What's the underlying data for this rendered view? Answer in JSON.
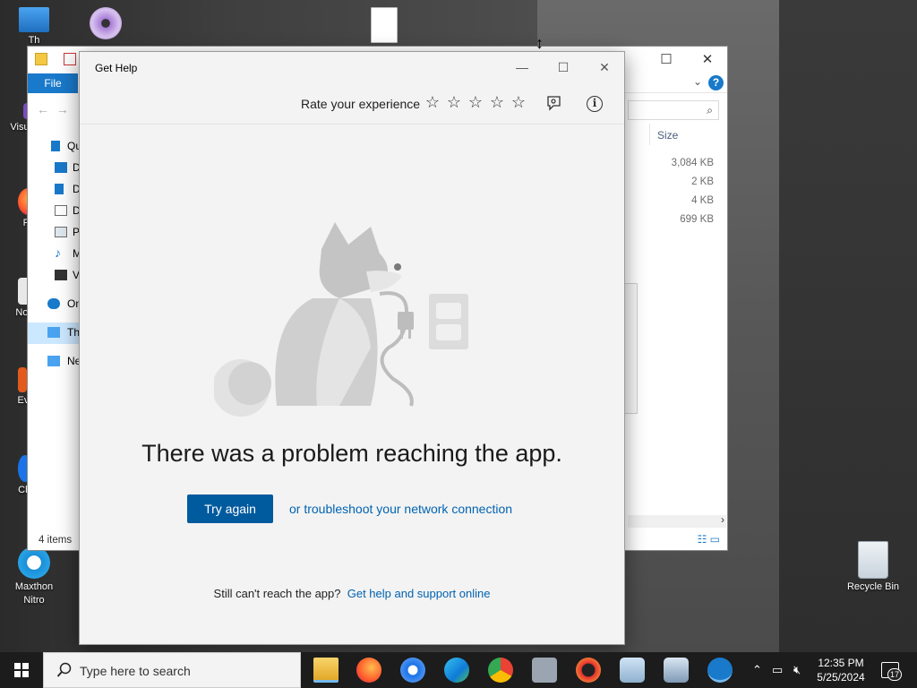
{
  "desktop": {
    "icons": [
      {
        "label": "Th",
        "name": "this-pc-icon"
      },
      {
        "label": "Visu",
        "name": "visual-studio-icon"
      },
      {
        "label": "F",
        "name": "firefox-desktop-icon"
      },
      {
        "label": "Note",
        "name": "notepad-icon"
      },
      {
        "label": "Eve",
        "name": "everything-icon"
      },
      {
        "label": "Chr",
        "name": "chrome-desktop-icon"
      },
      {
        "label": "Maxthon Nitro",
        "name": "maxthon-nitro-icon"
      },
      {
        "label": "Recycle Bin",
        "name": "recycle-bin-icon"
      }
    ]
  },
  "explorer": {
    "file_tab": "File",
    "help_label": "?",
    "sidebar": [
      {
        "label": "Qu",
        "color": "#1979ca"
      },
      {
        "label": "D",
        "color": "#1979ca"
      },
      {
        "label": "D",
        "color": "#1979ca"
      },
      {
        "label": "D",
        "color": "#6d6d6d"
      },
      {
        "label": "P",
        "color": "#6d6d6d"
      },
      {
        "label": "M",
        "color": "#1979ca"
      },
      {
        "label": "V",
        "color": "#333333"
      },
      {
        "label": "On",
        "color": "#1979ca"
      },
      {
        "label": "Th",
        "color": "#1979ca"
      },
      {
        "label": "Ne",
        "color": "#1979ca"
      }
    ],
    "size_header": "Size",
    "sizes": [
      "3,084 KB",
      "2 KB",
      "4 KB",
      "699 KB"
    ],
    "status": "4 items"
  },
  "get_help": {
    "title": "Get Help",
    "rate_label": "Rate your experience",
    "stars": [
      "☆",
      "☆",
      "☆",
      "☆",
      "☆"
    ],
    "error_heading": "There was a problem reaching the app.",
    "try_again": "Try again",
    "troubleshoot_link": "or troubleshoot your network connection",
    "still_text": "Still can't reach the app?",
    "support_link": "Get help and support online",
    "accent": "#005a9e"
  },
  "taskbar": {
    "search_placeholder": "Type here to search",
    "time": "12:35 PM",
    "date": "5/25/2024",
    "notification_count": "17",
    "apps": [
      "file-explorer",
      "firefox",
      "chrome-alt",
      "edge",
      "chrome",
      "camera",
      "opera",
      "remote-desktop",
      "task-scheduler",
      "get-help"
    ]
  }
}
